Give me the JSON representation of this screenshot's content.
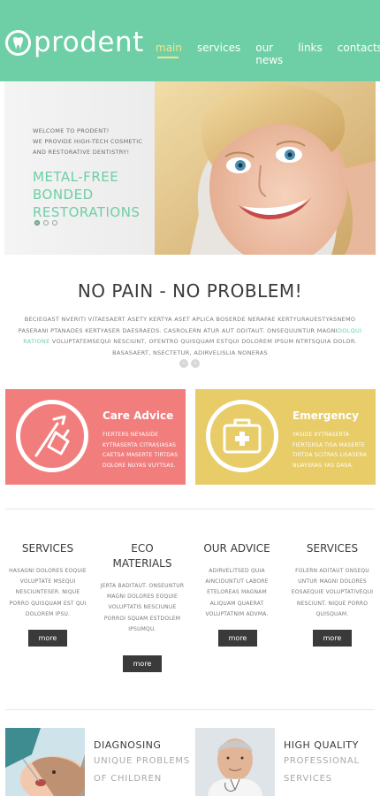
{
  "brand": {
    "logo_part1": "pro",
    "logo_part2": "dent"
  },
  "nav": {
    "items": [
      "main",
      "services",
      "our news",
      "links",
      "contacts"
    ],
    "active": "main"
  },
  "hero": {
    "welcome": "WELCOME TO PRODENT!",
    "line2": "WE PROVIDE HIGH-TECH COSMETIC",
    "line3": "AND RESTORATIVE DENTISTRY!",
    "title1": "METAL-FREE",
    "title2": "BONDED",
    "title3": "RESTORATIONS"
  },
  "intro": {
    "headline": "NO PAIN - NO PROBLEM!",
    "text_part1": "BECIEGAST NVERITI VITAESAERT ASETY KERTYA ASET APLICA BOSERDE NERAFAE KERTYURAUESTYASNEMO PASERANI PTANADES KERTYASER DAESRAEDS. CASROLERN ATUR AUT ODITAUT. ONSEQUUNTUR MAGNI",
    "text_highlight": "DOLQUI RATIONE",
    "text_part2": " VOLUPTATEMSEQUI NESCIUNT, OFENTRO QUISQUAM ESTQUI DOLOREM IPSUM NTRTSQUIA DOLOR. BASASAERT, NSECTETUR, ADIRVELISLIA NONERAS"
  },
  "cards": {
    "care": {
      "title": "Care Advice",
      "text": "FIERTERS NEYASIDE KYTRASERTA CITRASIASAS CAETSA MASERTE TIRTDAS DOLORE NUYAS VUYTSAS."
    },
    "emergency": {
      "title": "Emergency",
      "text": "YASIDE KYTRASERTA FIERTERSA TISA MASERTE TIRTDA SCITRAS LISASERA NUAYSRAS YAS DASA."
    }
  },
  "columns": [
    {
      "title1": "SERVICES",
      "title2": "",
      "text": "HASAGNI DOLORES EOQUIE VOLUPTATE MSEQUI NESCIUNTESER. NIQUE PORRO QUISQUAM EST QUI DOLOREM IPSU.",
      "button": "more"
    },
    {
      "title1": "ECO",
      "title2": "MATERIALS",
      "text": "JERTA BADITAUT. ONSEUNTUR MAGNI DOLORES EOQUIE VOLUPTATIS NESCIUNUE PORROI SQUAM ESTDOLEM IPSUMQU.",
      "button": "more"
    },
    {
      "title1": "OUR ADVICE",
      "title2": "",
      "text": "ADIRVELITSED QUIA AINCIDUNTUT LABORE ETELOREAS MAGNAM ALIQUAM QUAERAT VOLUPTATNIM ADVMA.",
      "button": "more"
    },
    {
      "title1": "SERVICES",
      "title2": "",
      "text": "FOLERN ADITAUT ONSEQU UNTUR MAGNI DOLORES EOSAEQUIE VOLUPTATIVEQUI NESCIUNT. NIQUE PORRO QUISQUAM.",
      "button": "more"
    }
  ],
  "bottom": {
    "left": {
      "title": "DIAGNOSING",
      "sub1": "UNIQUE PROBLEMS",
      "sub2": "OF CHILDREN"
    },
    "right": {
      "title": "HIGH QUALITY",
      "sub1": "PROFESSIONAL",
      "sub2": "SERVICES"
    }
  },
  "colors": {
    "mint": "#6ecfa6",
    "coral": "#f27d7d",
    "mustard": "#e8cc68",
    "dark": "#3a3a3a",
    "nav_active": "#f5e48a"
  }
}
